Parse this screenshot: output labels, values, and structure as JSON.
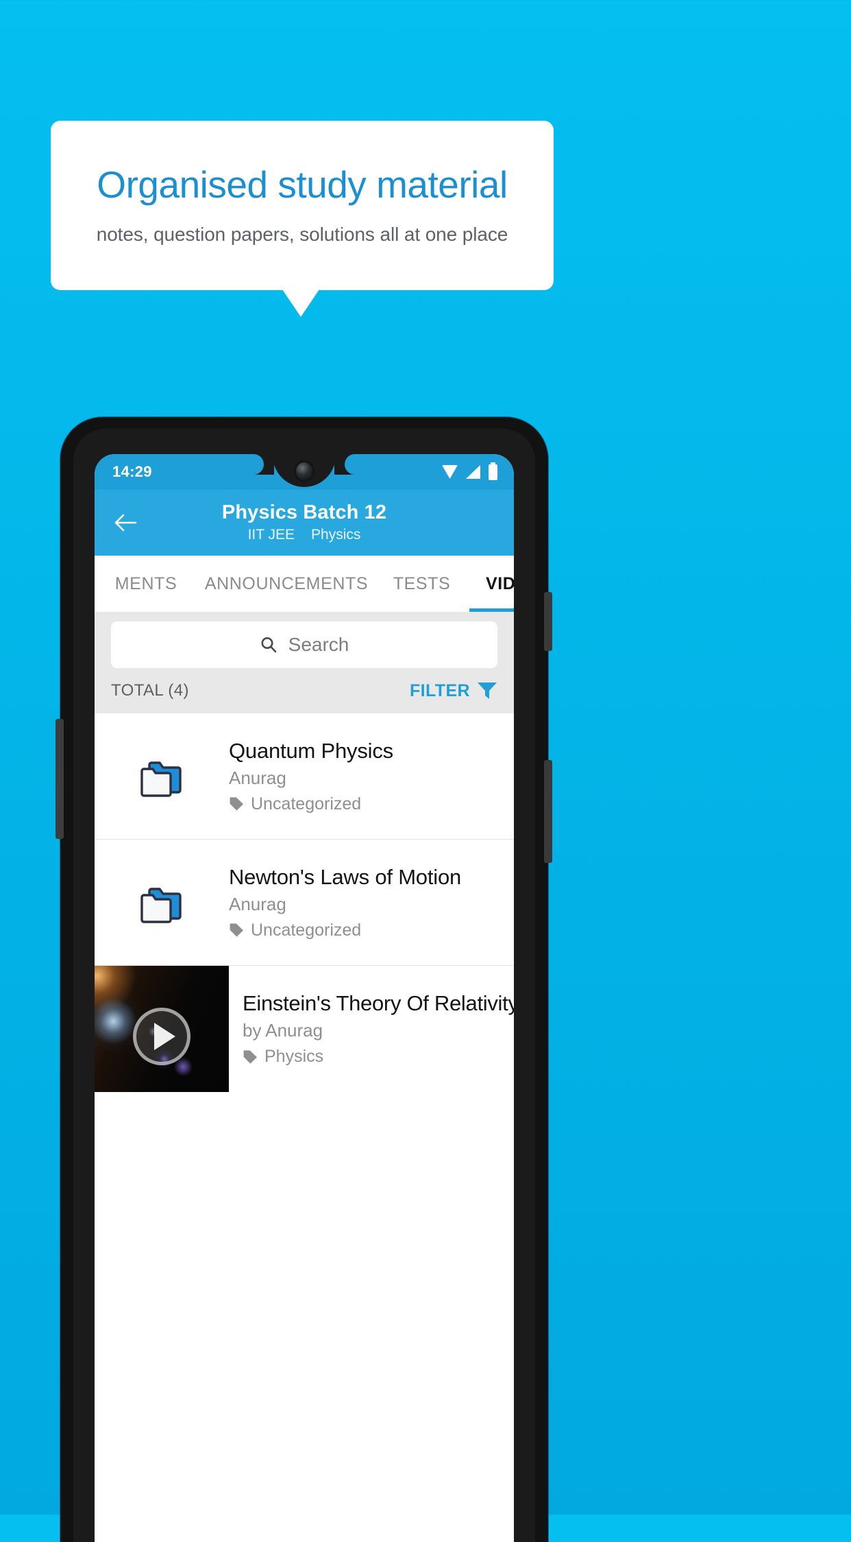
{
  "promo": {
    "title": "Organised study material",
    "subtitle": "notes, question papers, solutions all at one place",
    "title_color": "#1a8fd1",
    "subtitle_color": "#5c6266",
    "background_color": "#03b5e8"
  },
  "status_bar": {
    "time": "14:29",
    "icons": [
      "wifi-icon",
      "signal-icon",
      "battery-icon"
    ],
    "background_color": "#1f9fd8"
  },
  "app_bar": {
    "back_icon": "back-arrow-icon",
    "title": "Physics Batch 12",
    "subtitle_exam": "IIT JEE",
    "subtitle_subject": "Physics",
    "background_color": "#29a8e0"
  },
  "tabs": {
    "items": [
      {
        "label": "MENTS",
        "active": false
      },
      {
        "label": "ANNOUNCEMENTS",
        "active": false
      },
      {
        "label": "TESTS",
        "active": false
      },
      {
        "label": "VIDEOS",
        "active": true
      }
    ],
    "indicator_color": "#1f9fd8"
  },
  "search": {
    "placeholder": "Search",
    "value": "",
    "icon": "search-icon"
  },
  "toolbar": {
    "total_label": "TOTAL (4)",
    "filter_label": "FILTER",
    "filter_icon": "filter-icon",
    "filter_color": "#1f9fd8"
  },
  "list": {
    "items": [
      {
        "type": "folder",
        "icon": "folder-icon",
        "title": "Quantum Physics",
        "author": "Anurag",
        "tag": "Uncategorized",
        "tag_icon": "tag-icon"
      },
      {
        "type": "folder",
        "icon": "folder-icon",
        "title": "Newton's Laws of Motion",
        "author": "Anurag",
        "tag": "Uncategorized",
        "tag_icon": "tag-icon"
      },
      {
        "type": "video",
        "icon": "play-icon",
        "title": "Einstein's Theory Of Relativity",
        "author": "by Anurag",
        "tag": "Physics",
        "tag_icon": "tag-icon"
      }
    ]
  }
}
